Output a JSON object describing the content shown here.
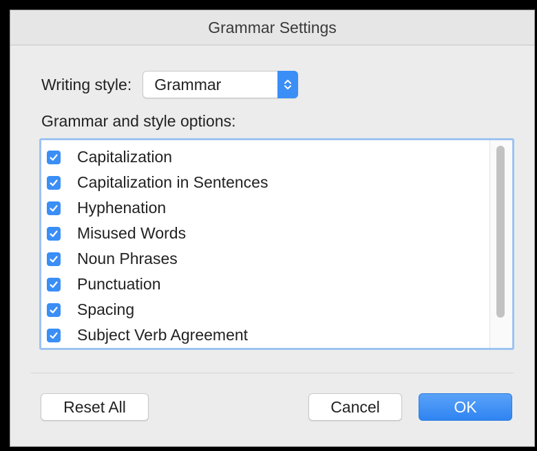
{
  "window": {
    "title": "Grammar Settings"
  },
  "writing_style": {
    "label": "Writing style:",
    "value": "Grammar"
  },
  "options": {
    "label": "Grammar and style options:",
    "items": [
      {
        "label": "Capitalization",
        "checked": true
      },
      {
        "label": "Capitalization in Sentences",
        "checked": true
      },
      {
        "label": "Hyphenation",
        "checked": true
      },
      {
        "label": "Misused Words",
        "checked": true
      },
      {
        "label": "Noun Phrases",
        "checked": true
      },
      {
        "label": "Punctuation",
        "checked": true
      },
      {
        "label": "Spacing",
        "checked": true
      },
      {
        "label": "Subject Verb Agreement",
        "checked": true
      }
    ]
  },
  "buttons": {
    "reset": "Reset All",
    "cancel": "Cancel",
    "ok": "OK"
  },
  "colors": {
    "accent": "#3a8ef6",
    "background": "#ececec"
  }
}
